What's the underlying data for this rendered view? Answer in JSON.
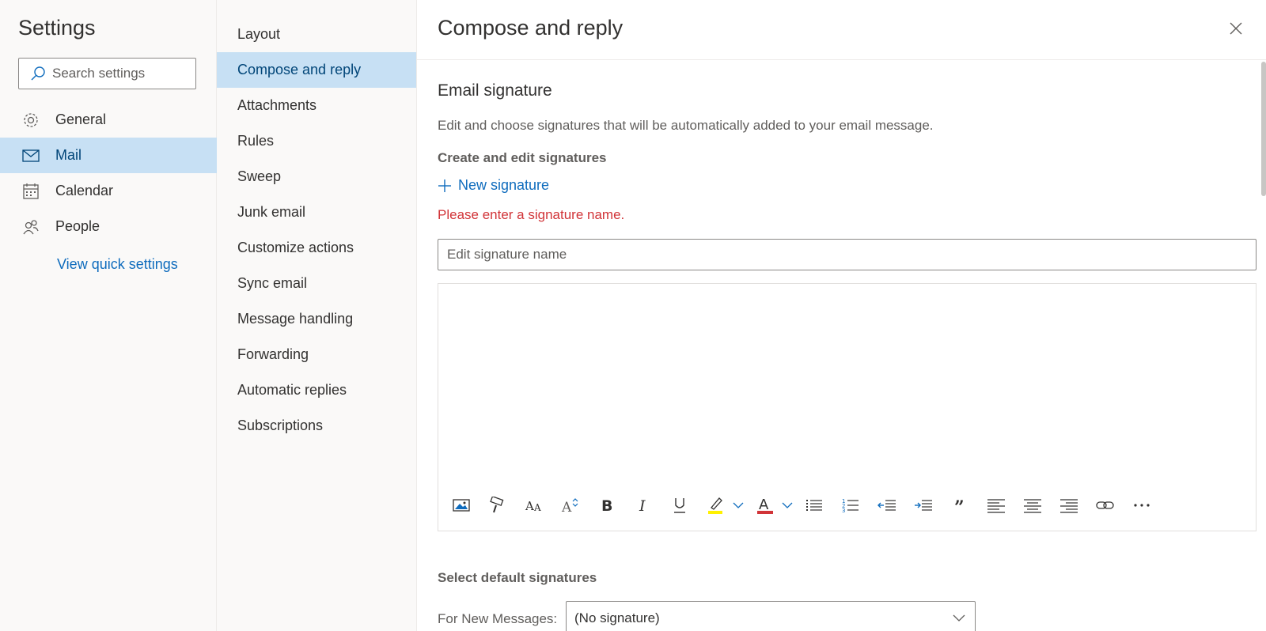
{
  "settings": {
    "title": "Settings",
    "search_placeholder": "Search settings",
    "categories": [
      {
        "label": "General",
        "icon": "gear-icon"
      },
      {
        "label": "Mail",
        "icon": "mail-icon",
        "selected": true
      },
      {
        "label": "Calendar",
        "icon": "calendar-icon"
      },
      {
        "label": "People",
        "icon": "people-icon"
      }
    ],
    "quick_settings_link": "View quick settings"
  },
  "mail_sections": [
    {
      "label": "Layout"
    },
    {
      "label": "Compose and reply",
      "selected": true
    },
    {
      "label": "Attachments"
    },
    {
      "label": "Rules"
    },
    {
      "label": "Sweep"
    },
    {
      "label": "Junk email"
    },
    {
      "label": "Customize actions"
    },
    {
      "label": "Sync email"
    },
    {
      "label": "Message handling"
    },
    {
      "label": "Forwarding"
    },
    {
      "label": "Automatic replies"
    },
    {
      "label": "Subscriptions"
    }
  ],
  "panel": {
    "title": "Compose and reply",
    "section_title": "Email signature",
    "description": "Edit and choose signatures that will be automatically added to your email message.",
    "create_title": "Create and edit signatures",
    "new_signature": "New signature",
    "error": "Please enter a signature name.",
    "signature_name_placeholder": "Edit signature name",
    "toolbar": [
      "insert-picture-icon",
      "format-painter-icon",
      "font-icon",
      "font-size-icon",
      "bold-icon",
      "italic-icon",
      "underline-icon",
      "highlight-icon",
      "highlight-dropdown-icon",
      "font-color-icon",
      "font-color-dropdown-icon",
      "bullets-icon",
      "numbering-icon",
      "decrease-indent-icon",
      "increase-indent-icon",
      "quote-icon",
      "align-left-icon",
      "align-center-icon",
      "align-right-icon",
      "link-icon",
      "more-options-icon"
    ],
    "default_title": "Select default signatures",
    "for_new_label": "For New Messages:",
    "for_new_value": "(No signature)"
  },
  "colors": {
    "accent": "#0f6cbd",
    "selected_bg": "#c7e0f4",
    "error": "#d13438",
    "highlight": "#fff100",
    "font_color": "#d13438"
  }
}
